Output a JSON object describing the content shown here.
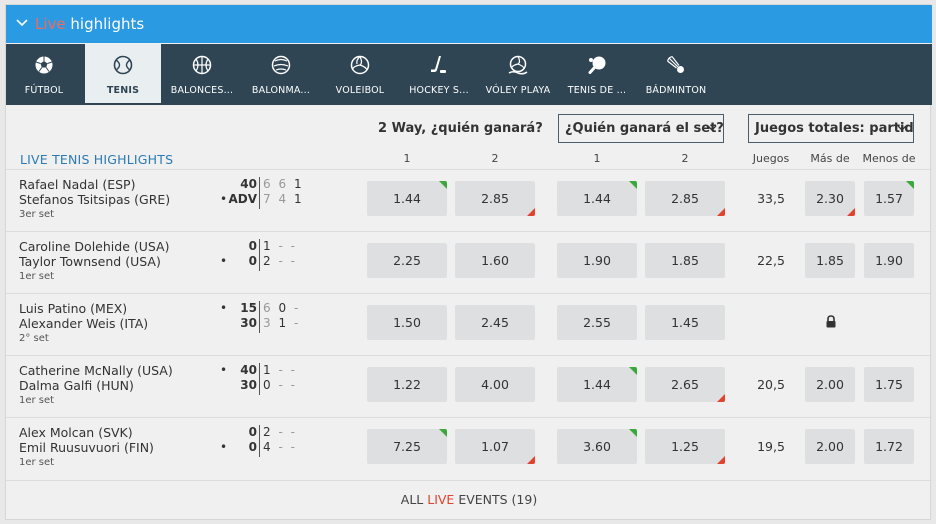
{
  "header": {
    "live_word": "Live",
    "title_rest": " highlights"
  },
  "nav": {
    "tabs": [
      {
        "label": "FÚTBOL",
        "icon": "soccer-ball-icon"
      },
      {
        "label": "TENIS",
        "icon": "tennis-ball-icon",
        "active": true
      },
      {
        "label": "BALONCES...",
        "icon": "basketball-icon"
      },
      {
        "label": "BALONMA...",
        "icon": "handball-icon"
      },
      {
        "label": "VOLEIBOL",
        "icon": "volleyball-icon"
      },
      {
        "label": "HOCKEY S...",
        "icon": "hockey-stick-icon"
      },
      {
        "label": "VÓLEY PLAYA",
        "icon": "beach-volleyball-icon"
      },
      {
        "label": "TENIS DE ...",
        "icon": "table-tennis-icon"
      },
      {
        "label": "BÁDMINTON",
        "icon": "shuttlecock-icon"
      }
    ]
  },
  "markets": {
    "two_way": "2 Way, ¿quién ganará?",
    "set_winner": "¿Quién ganará el set?",
    "total_games": "Juegos totales: partid",
    "section_title": "LIVE TENIS HIGHLIGHTS",
    "sub": {
      "one": "1",
      "two": "2",
      "one_b": "1",
      "two_b": "2",
      "juegos": "Juegos",
      "mas": "Más de",
      "menos": "Menos de"
    }
  },
  "matches": [
    {
      "p1": "Rafael Nadal (ESP)",
      "p2": "Stefanos Tsitsipas (GRE)",
      "period": "3er set",
      "pts1": "40",
      "pts2": "ADV",
      "serve": 2,
      "sets1": [
        "6",
        "6",
        "1"
      ],
      "sets2": [
        "7",
        "4",
        "1"
      ],
      "cur1": "1",
      "cur2": "1",
      "w1": "1.44",
      "w2": "2.85",
      "s1": "1.44",
      "s2": "2.85",
      "games": "33,5",
      "over": "2.30",
      "under": "1.57"
    },
    {
      "p1": "Caroline Dolehide (USA)",
      "p2": "Taylor Townsend (USA)",
      "period": "1er set",
      "pts1": "0",
      "pts2": "0",
      "serve": 2,
      "sets1": [
        "1",
        "-",
        "-"
      ],
      "sets2": [
        "2",
        "-",
        "-"
      ],
      "w1": "2.25",
      "w2": "1.60",
      "s1": "1.90",
      "s2": "1.85",
      "games": "22,5",
      "over": "1.85",
      "under": "1.90"
    },
    {
      "p1": "Luis Patino (MEX)",
      "p2": "Alexander Weis (ITA)",
      "period": "2° set",
      "pts1": "15",
      "pts2": "30",
      "serve": 1,
      "sets1": [
        "6",
        "0",
        "-"
      ],
      "sets2": [
        "3",
        "1",
        "-"
      ],
      "w1": "1.50",
      "w2": "2.45",
      "s1": "2.55",
      "s2": "1.45",
      "games": "",
      "over": "",
      "under": "",
      "locked": true
    },
    {
      "p1": "Catherine McNally (USA)",
      "p2": "Dalma Galfi (HUN)",
      "period": "1er set",
      "pts1": "40",
      "pts2": "30",
      "serve": 1,
      "sets1": [
        "1",
        "-",
        "-"
      ],
      "sets2": [
        "0",
        "-",
        "-"
      ],
      "w1": "1.22",
      "w2": "4.00",
      "s1": "1.44",
      "s2": "2.65",
      "games": "20,5",
      "over": "2.00",
      "under": "1.75"
    },
    {
      "p1": "Alex Molcan (SVK)",
      "p2": "Emil Ruusuvuori (FIN)",
      "period": "1er set",
      "pts1": "0",
      "pts2": "0",
      "serve": 2,
      "sets1": [
        "2",
        "-",
        "-"
      ],
      "sets2": [
        "4",
        "-",
        "-"
      ],
      "w1": "7.25",
      "w2": "1.07",
      "s1": "3.60",
      "s2": "1.25",
      "games": "19,5",
      "over": "2.00",
      "under": "1.72"
    }
  ],
  "footer": {
    "all": "ALL ",
    "live": "LIVE",
    "events": " EVENTS (19)"
  },
  "colors": {
    "brand_blue": "#2a9ae2",
    "nav_bg": "#2f4554",
    "up": "#3aa83a",
    "down": "#e0432f"
  }
}
